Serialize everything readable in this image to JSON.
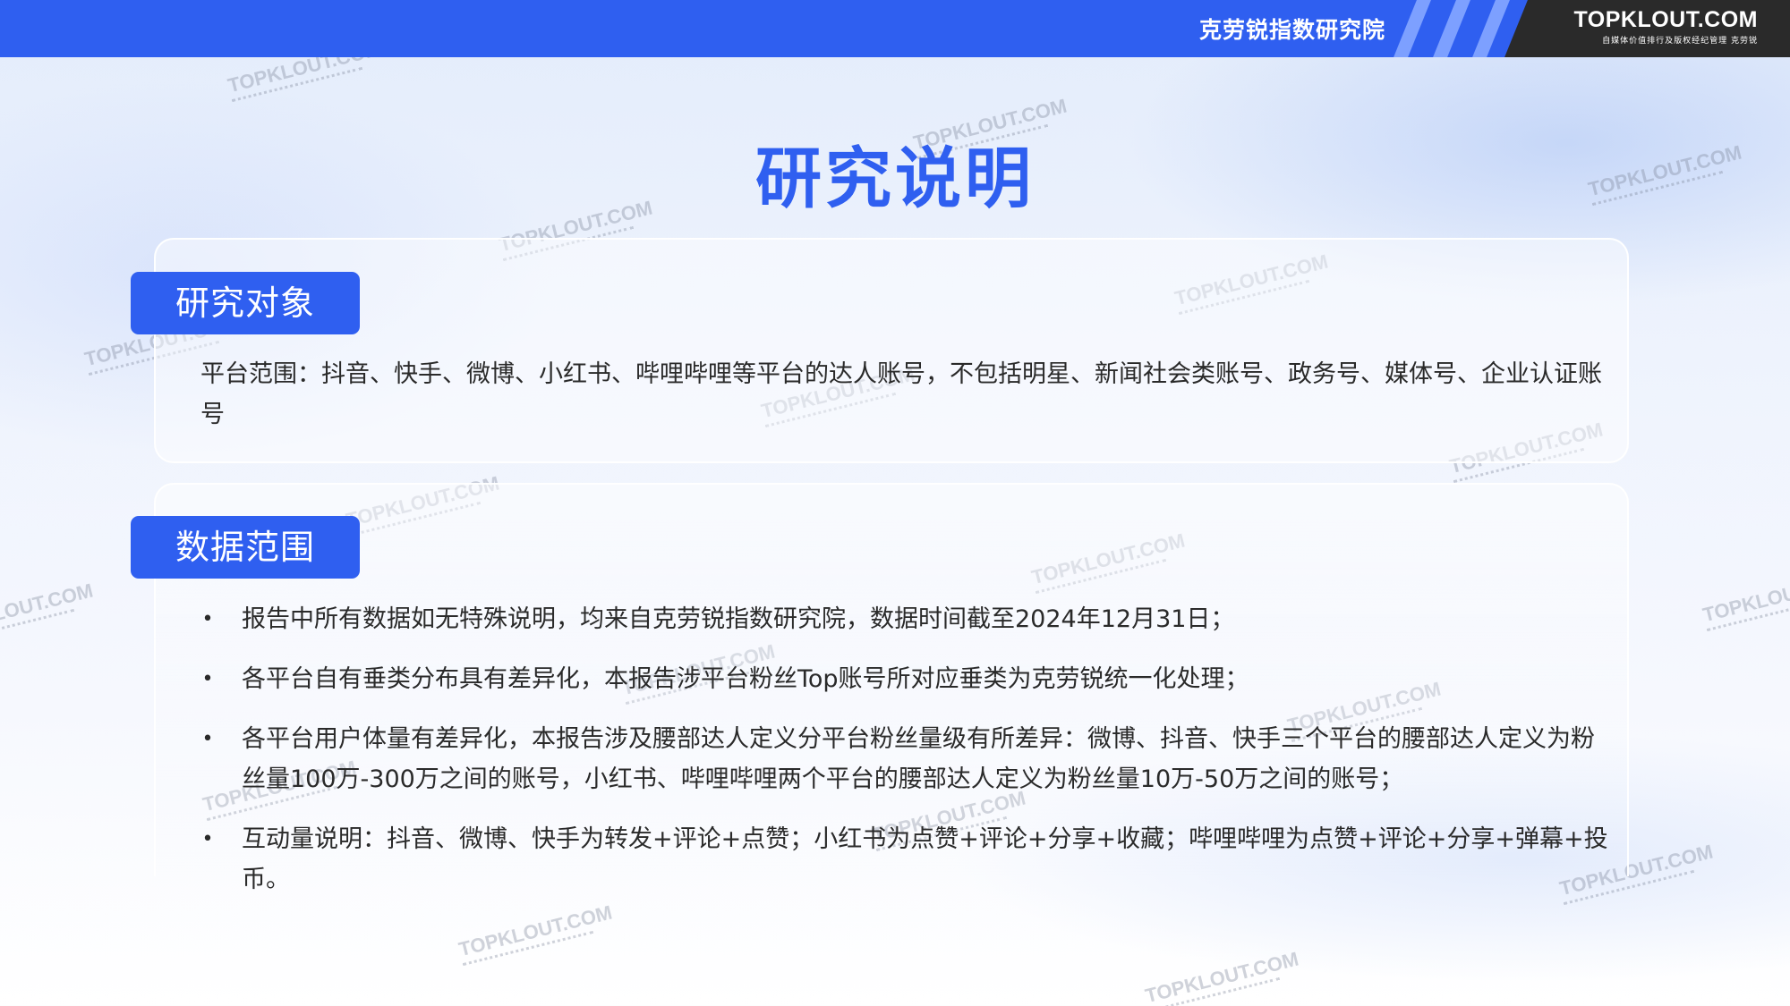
{
  "header": {
    "institute": "克劳锐指数研究院",
    "brand": "TOPKLOUT.COM",
    "brand_tagline": "自媒体价值排行及版权经纪管理 克劳锐"
  },
  "page_title": "研究说明",
  "research_object": {
    "label": "研究对象",
    "text": "平台范围：抖音、快手、微博、小红书、哔哩哔哩等平台的达人账号，不包括明星、新闻社会类账号、政务号、媒体号、企业认证账号"
  },
  "data_scope": {
    "label": "数据范围",
    "bullet": "•",
    "items": [
      "报告中所有数据如无特殊说明，均来自克劳锐指数研究院，数据时间截至2024年12月31日；",
      "各平台自有垂类分布具有差异化，本报告涉平台粉丝Top账号所对应垂类为克劳锐统一化处理；",
      "各平台用户体量有差异化，本报告涉及腰部达人定义分平台粉丝量级有所差异：微博、抖音、快手三个平台的腰部达人定义为粉丝量100万-300万之间的账号，小红书、哔哩哔哩两个平台的腰部达人定义为粉丝量10万-50万之间的账号；",
      "互动量说明：抖音、微博、快手为转发+评论+点赞；小红书为点赞+评论+分享+收藏；哔哩哔哩为点赞+评论+分享+弹幕+投币。"
    ]
  },
  "watermark_text": "TOPKLOUT.COM",
  "colors": {
    "accent": "#2f5ff0",
    "text": "#2a2a2a",
    "brand_block": "#2a2a2a"
  }
}
